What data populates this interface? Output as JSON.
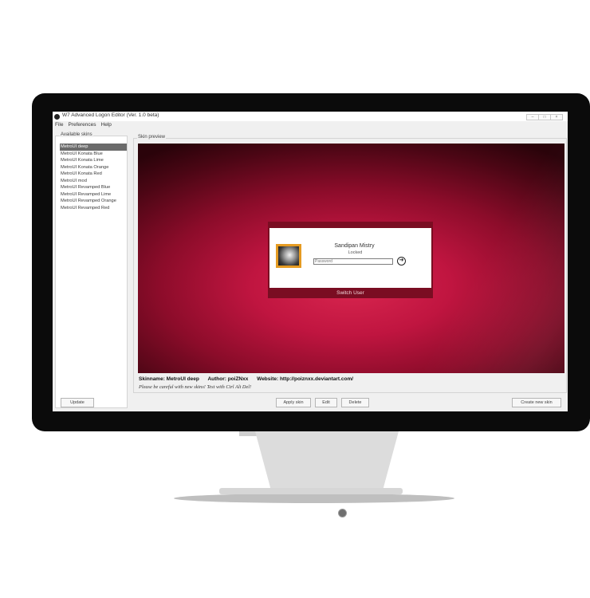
{
  "window": {
    "title": "W7 Advanced Logon Editor (Ver. 1.0 beta)",
    "controls": [
      "–",
      "□",
      "×"
    ]
  },
  "menu": [
    "File",
    "Preferences",
    "Help"
  ],
  "left_panel": {
    "legend": "Available skins",
    "skins": [
      "MetroUI deep",
      "MetroUI Konata Blue",
      "MetroUI Konata Lime",
      "MetroUI Konata Orange",
      "MetroUI Konata Red",
      "MetroUI mod",
      "MetroUI Revamped Blue",
      "MetroUI Revamped Lime",
      "MetroUI Revamped Orange",
      "MetroUI Revamped Red"
    ],
    "selected_index": 0,
    "update_label": "Update"
  },
  "preview": {
    "legend": "Skin preview",
    "user_name": "Sandipan Mistry",
    "status": "Locked",
    "password_placeholder": "Password",
    "switch_user": "Switch User"
  },
  "info": {
    "skinname": "Skinname:  MetroUI deep",
    "author": "Author:  poiZNxx",
    "website": "Website:  http://poiznxx.deviantart.com/",
    "warning": "Please be careful with new skins! Test with Ctrl Alt Del!"
  },
  "buttons": {
    "apply": "Apply skin",
    "edit": "Edit",
    "delete": "Delete",
    "create": "Create new skin"
  },
  "colors": {
    "bezel": "#0b0b0b",
    "accent_red": "#c01540",
    "avatar_frame": "#e59b22",
    "selection": "#6b6b6b"
  }
}
